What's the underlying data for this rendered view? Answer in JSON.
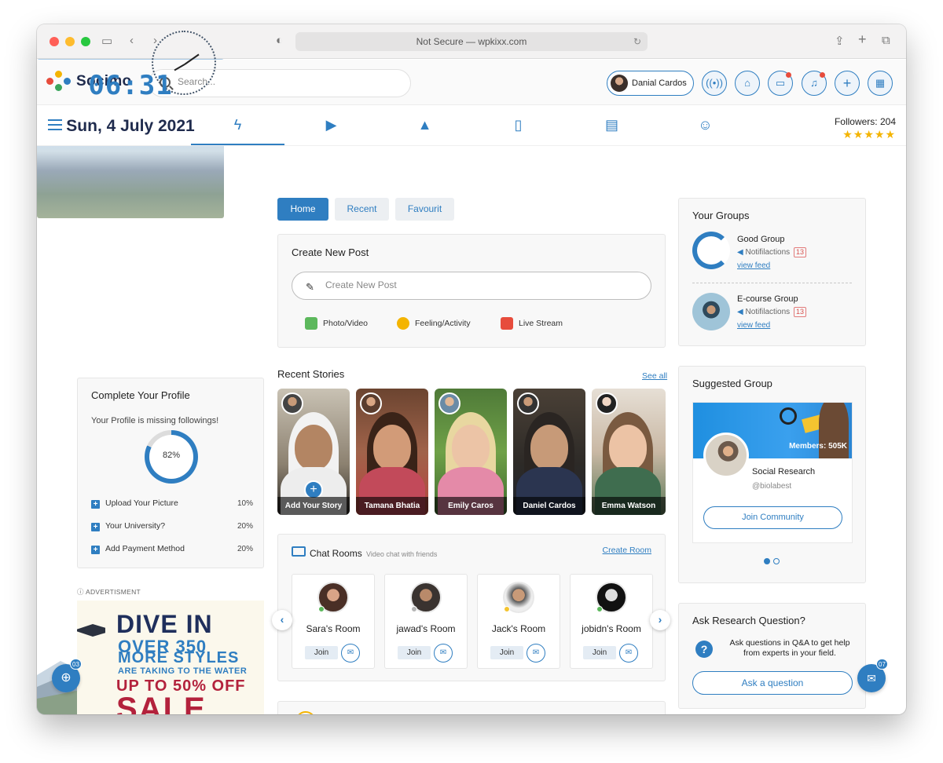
{
  "browser": {
    "url_text": "Not Secure — wpkixx.com"
  },
  "header": {
    "logo_text": "Socimo",
    "search_placeholder": "Search...",
    "user_name": "Danial Cardos",
    "icons": [
      "broadcast-icon",
      "home-icon",
      "chat-icon",
      "bell-icon",
      "plus-icon",
      "grid-icon"
    ]
  },
  "nav": {
    "tabs": [
      "lightning-icon",
      "video-icon",
      "airplay-icon",
      "book-icon",
      "layout-icon",
      "users-icon"
    ],
    "active_index": 0,
    "followers_text": "Followers: 204",
    "stars": "★★★★★",
    "rating": 5
  },
  "clock": {
    "time": "06:31",
    "date": "Sun, 4 July 2021"
  },
  "profile": {
    "title": "Complete Your Profile",
    "subtitle": "Your Profile is missing followings!",
    "percent_label": "82%",
    "percent": 82,
    "items": [
      {
        "label": "Upload Your Picture",
        "pct": "10%"
      },
      {
        "label": "Your University?",
        "pct": "20%"
      },
      {
        "label": "Add Payment Method",
        "pct": "20%"
      }
    ]
  },
  "advert": {
    "label": "ADVERTISMENT",
    "line1": "DIVE IN",
    "line2": "OVER 350",
    "line3": "MORE STYLES",
    "line4": "ARE TAKING TO THE WATER",
    "line5": "UP TO 50% OFF",
    "line6": "SALE"
  },
  "cart": {
    "badge": "03"
  },
  "feed_tabs": [
    "Home",
    "Recent",
    "Favourit"
  ],
  "new_post": {
    "title": "Create New Post",
    "placeholder": "Create New Post",
    "actions": [
      "Photo/Video",
      "Feeling/Activity",
      "Live Stream"
    ]
  },
  "stories": {
    "title": "Recent Stories",
    "see_all": "See all",
    "items": [
      "Add Your Story",
      "Tamana Bhatia",
      "Emily Caros",
      "Daniel Cardos",
      "Emma Watson"
    ]
  },
  "chat_rooms": {
    "title": "Chat Rooms",
    "subtitle": "Video chat with friends",
    "create": "Create Room",
    "join_label": "Join",
    "rooms": [
      "Sara's Room",
      "jawad's Room",
      "Jack's Room",
      "jobidn's Room"
    ],
    "status_colors": [
      "#5cb85c",
      "#b5b5b5",
      "#f4c430",
      "#5cb85c"
    ]
  },
  "groups": {
    "title": "Your Groups",
    "items": [
      {
        "name": "Good Group",
        "noti": "Notifilactions",
        "count": "13",
        "feed": "view feed"
      },
      {
        "name": "E-course Group",
        "noti": "Notifilactions",
        "count": "13",
        "feed": "view feed"
      }
    ]
  },
  "suggested": {
    "title": "Suggested Group",
    "members": "Members: 505K",
    "name": "Social Research",
    "handle": "@biolabest",
    "join": "Join Community"
  },
  "ask": {
    "title": "Ask Research Question?",
    "text": "Ask questions in Q&A to get help from experts in your field.",
    "button": "Ask a question"
  },
  "messenger": {
    "badge": "07"
  },
  "colors": {
    "accent": "#2f7ec1",
    "dark": "#1f2b4d",
    "alert": "#e74c3c"
  }
}
